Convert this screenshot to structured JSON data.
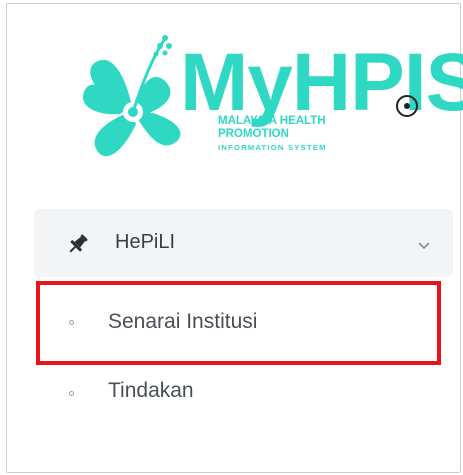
{
  "logo": {
    "wordmark": "MyHPIS",
    "line1": "MALAYSIA HEALTH",
    "line2": "PROMOTION",
    "line3": "INFORMATION SYSTEM",
    "color": "#2fd8c3"
  },
  "sidebar": {
    "toggle_icon": "circle-dot-icon",
    "group": {
      "label": "HePiLI",
      "icon": "pin-icon",
      "chevron": "chevron-down-icon",
      "expanded": true
    },
    "items": [
      {
        "label": "Senarai Institusi",
        "highlighted": true
      },
      {
        "label": "Tindakan",
        "highlighted": false
      }
    ],
    "highlight_color": "#e8141a"
  }
}
